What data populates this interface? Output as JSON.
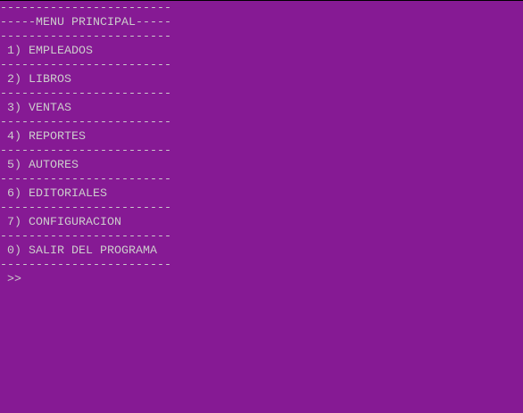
{
  "colors": {
    "background": "#861a94",
    "text": "#cccccc"
  },
  "console": {
    "separator": "------------------------",
    "title": "-----MENU PRINCIPAL-----",
    "menu_items": [
      " 1) EMPLEADOS",
      " 2) LIBROS",
      " 3) VENTAS",
      " 4) REPORTES",
      " 5) AUTORES",
      " 6) EDITORIALES",
      " 7) CONFIGURACION",
      " 0) SALIR DEL PROGRAMA"
    ],
    "prompt": " >>"
  }
}
